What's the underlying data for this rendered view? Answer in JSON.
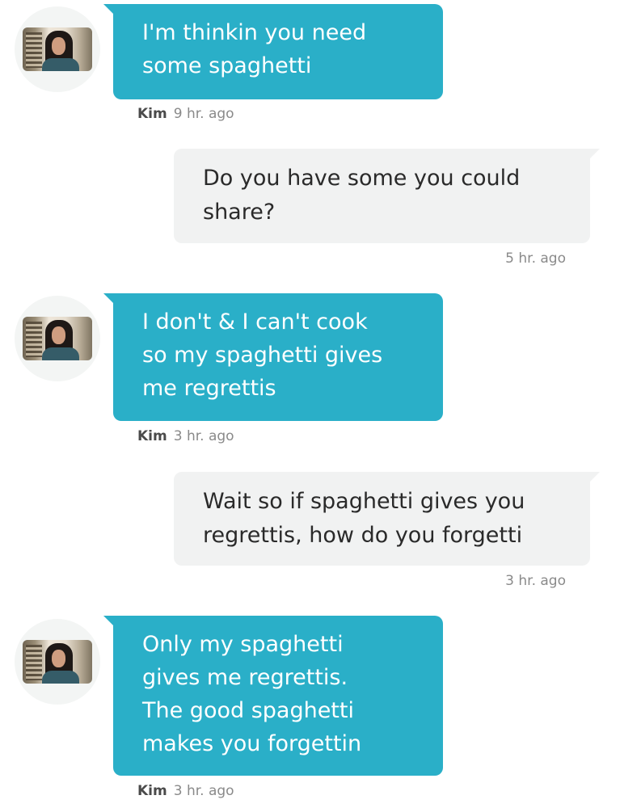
{
  "conversation": {
    "messages": [
      {
        "direction": "in",
        "sender": "Kim",
        "time": "9 hr. ago",
        "lines": [
          "I'm thinkin you need",
          "some spaghetti"
        ]
      },
      {
        "direction": "out",
        "time": "5 hr. ago",
        "lines": [
          "Do you have some you could",
          "share?"
        ]
      },
      {
        "direction": "in",
        "sender": "Kim",
        "time": "3 hr. ago",
        "lines": [
          "I don't & I can't cook",
          "so my spaghetti gives",
          "me regrettis"
        ]
      },
      {
        "direction": "out",
        "time": "3 hr. ago",
        "lines": [
          "Wait so if spaghetti gives you",
          "regrettis, how do you forgetti"
        ]
      },
      {
        "direction": "in",
        "sender": "Kim",
        "time": "3 hr. ago",
        "lines": [
          "Only my spaghetti",
          "gives me regrettis.",
          "The good spaghetti",
          "makes you forgettin"
        ]
      }
    ]
  },
  "colors": {
    "incoming_bubble": "#2aafc8",
    "outgoing_bubble": "#f1f2f2",
    "timestamp": "#8a8a8a"
  }
}
